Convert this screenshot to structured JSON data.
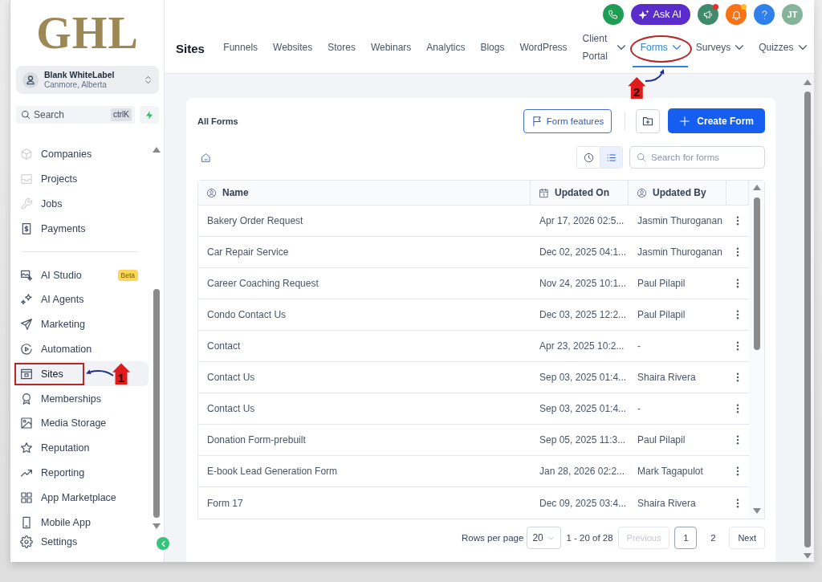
{
  "logo": {
    "text": "GHL"
  },
  "account": {
    "name": "Blank WhiteLabel",
    "location": "Canmore, Alberta"
  },
  "search": {
    "placeholder": "Search",
    "shortcut": "ctrlK"
  },
  "sidebar": {
    "groups": [
      {
        "items": [
          {
            "label": "Companies",
            "selected": false
          },
          {
            "label": "Projects",
            "selected": false
          },
          {
            "label": "Jobs",
            "selected": false
          },
          {
            "label": "Payments",
            "selected": false
          }
        ]
      },
      {
        "items": [
          {
            "label": "AI Studio",
            "selected": false,
            "badge": "Beta"
          },
          {
            "label": "AI Agents",
            "selected": false
          },
          {
            "label": "Marketing",
            "selected": false
          },
          {
            "label": "Automation",
            "selected": false
          },
          {
            "label": "Sites",
            "selected": true,
            "callout": "1"
          },
          {
            "label": "Memberships",
            "selected": false
          },
          {
            "label": "Media Storage",
            "selected": false
          },
          {
            "label": "Reputation",
            "selected": false
          },
          {
            "label": "Reporting",
            "selected": false
          },
          {
            "label": "App Marketplace",
            "selected": false
          },
          {
            "label": "Mobile App",
            "selected": false
          }
        ]
      }
    ],
    "bottom_items": [
      {
        "label": "Settings",
        "selected": false
      }
    ]
  },
  "header": {
    "actions": {
      "ask_ai": "Ask AI",
      "announcements_unread": true,
      "notifications_unread": true,
      "avatar": "JT"
    },
    "section": "Sites",
    "tabs": [
      {
        "label": "Funnels",
        "selected": false,
        "dropdown": false
      },
      {
        "label": "Websites",
        "selected": false,
        "dropdown": false
      },
      {
        "label": "Stores",
        "selected": false,
        "dropdown": false
      },
      {
        "label": "Webinars",
        "selected": false,
        "dropdown": false
      },
      {
        "label": "Analytics",
        "selected": false,
        "dropdown": false
      },
      {
        "label": "Blogs",
        "selected": false,
        "dropdown": false
      },
      {
        "label": "WordPress",
        "selected": false,
        "dropdown": false
      },
      {
        "label": "Client Portal",
        "selected": false,
        "dropdown": true
      },
      {
        "label": "Forms",
        "selected": true,
        "dropdown": true,
        "callout": "2"
      },
      {
        "label": "Surveys",
        "selected": false,
        "dropdown": true
      },
      {
        "label": "Quizzes",
        "selected": false,
        "dropdown": true
      }
    ]
  },
  "forms_panel": {
    "title": "All Forms",
    "features_button": "Form features",
    "create_button": "Create Form",
    "view_toggle": [
      {
        "selected": false
      },
      {
        "selected": true
      }
    ],
    "search": {
      "placeholder": "Search for forms"
    },
    "table": {
      "columns": [
        "Name",
        "Updated On",
        "Updated By"
      ],
      "rows": [
        {
          "name": "Bakery Order Request",
          "updated_on": "Apr 17, 2026 02:5...",
          "updated_by": "Jasmin Thuroganan"
        },
        {
          "name": "Car Repair Service",
          "updated_on": "Dec 02, 2025 04:1...",
          "updated_by": "Jasmin Thuroganan"
        },
        {
          "name": "Career Coaching Request",
          "updated_on": "Nov 24, 2025 10:1...",
          "updated_by": "Paul Pilapil"
        },
        {
          "name": "Condo Contact Us",
          "updated_on": "Dec 03, 2025 12:2...",
          "updated_by": "Paul Pilapil"
        },
        {
          "name": "Contact",
          "updated_on": "Apr 23, 2025 10:2...",
          "updated_by": "-"
        },
        {
          "name": "Contact Us",
          "updated_on": "Sep 03, 2025 01:4...",
          "updated_by": "Shaira Rivera"
        },
        {
          "name": "Contact Us",
          "updated_on": "Sep 03, 2025 01:4...",
          "updated_by": "-"
        },
        {
          "name": "Donation Form-prebuilt",
          "updated_on": "Sep 05, 2025 11:3...",
          "updated_by": "Paul Pilapil"
        },
        {
          "name": "E-book Lead Generation Form",
          "updated_on": "Jan 28, 2026 02:2...",
          "updated_by": "Mark Tagapulot"
        },
        {
          "name": "Form 17",
          "updated_on": "Dec 09, 2025 03:4...",
          "updated_by": "Shaira Rivera"
        }
      ]
    },
    "pagination": {
      "rows_label": "Rows per page",
      "rows_per_page": "20",
      "range": "1 - 20 of 28",
      "previous": {
        "label": "Previous",
        "disabled": true
      },
      "pages": [
        {
          "label": "1",
          "selected": true
        },
        {
          "label": "2",
          "selected": false
        }
      ],
      "next": {
        "label": "Next",
        "disabled": false
      }
    }
  }
}
